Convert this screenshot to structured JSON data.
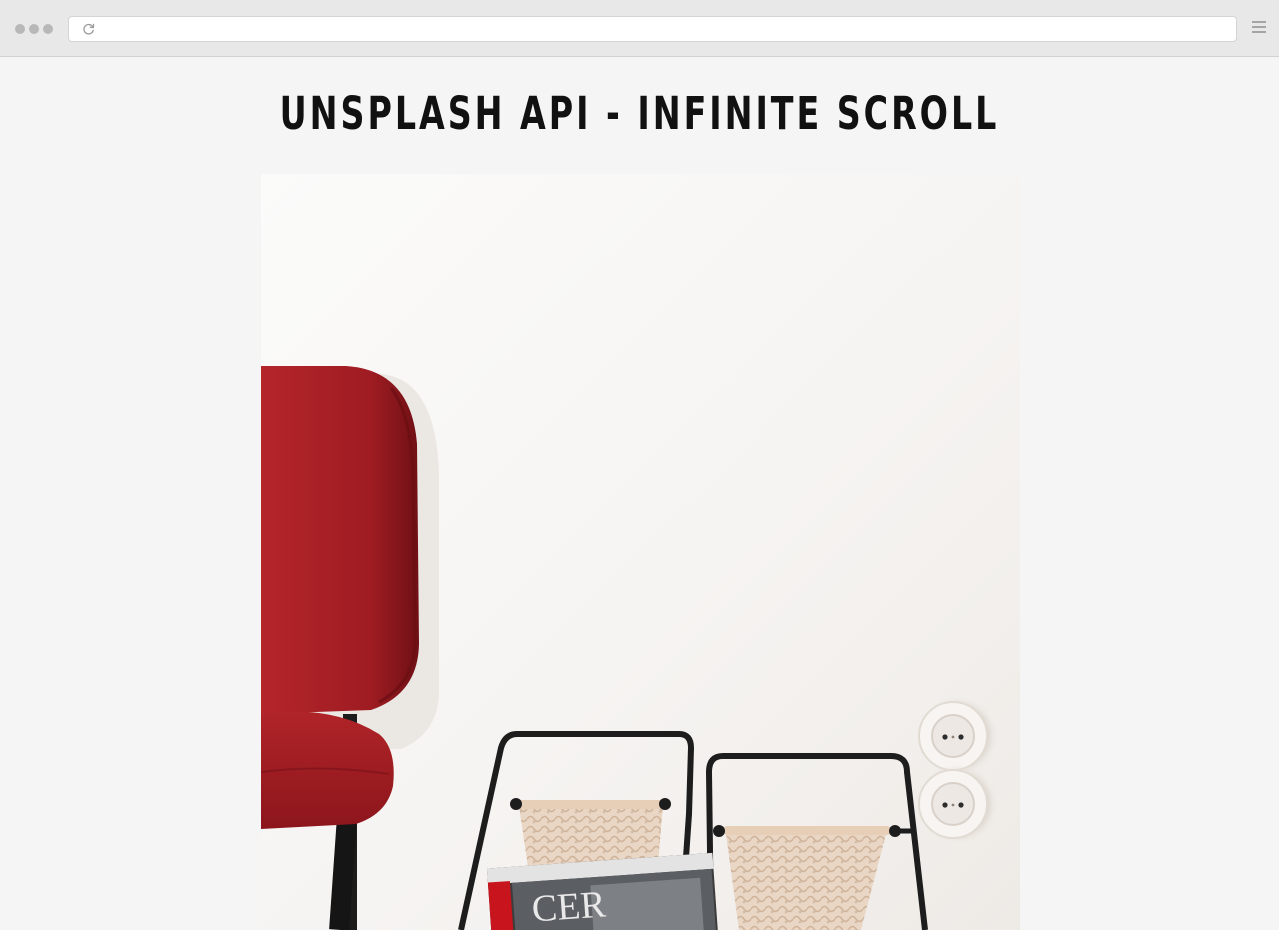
{
  "browser": {
    "address_value": "",
    "address_placeholder": "",
    "icons": [
      "window-controls",
      "reload-icon",
      "menu-icon"
    ]
  },
  "page": {
    "title": "UNSPLASH API - INFINITE SCROLL"
  },
  "gallery": {
    "photos": [
      {
        "name": "photo-red-chair-magazine-rack",
        "magazine_text": "CER"
      }
    ]
  },
  "colors": {
    "background": "#f5f5f5",
    "chrome": "#e8e8e8",
    "title": "#111111",
    "chair_red": "#a61f24"
  }
}
